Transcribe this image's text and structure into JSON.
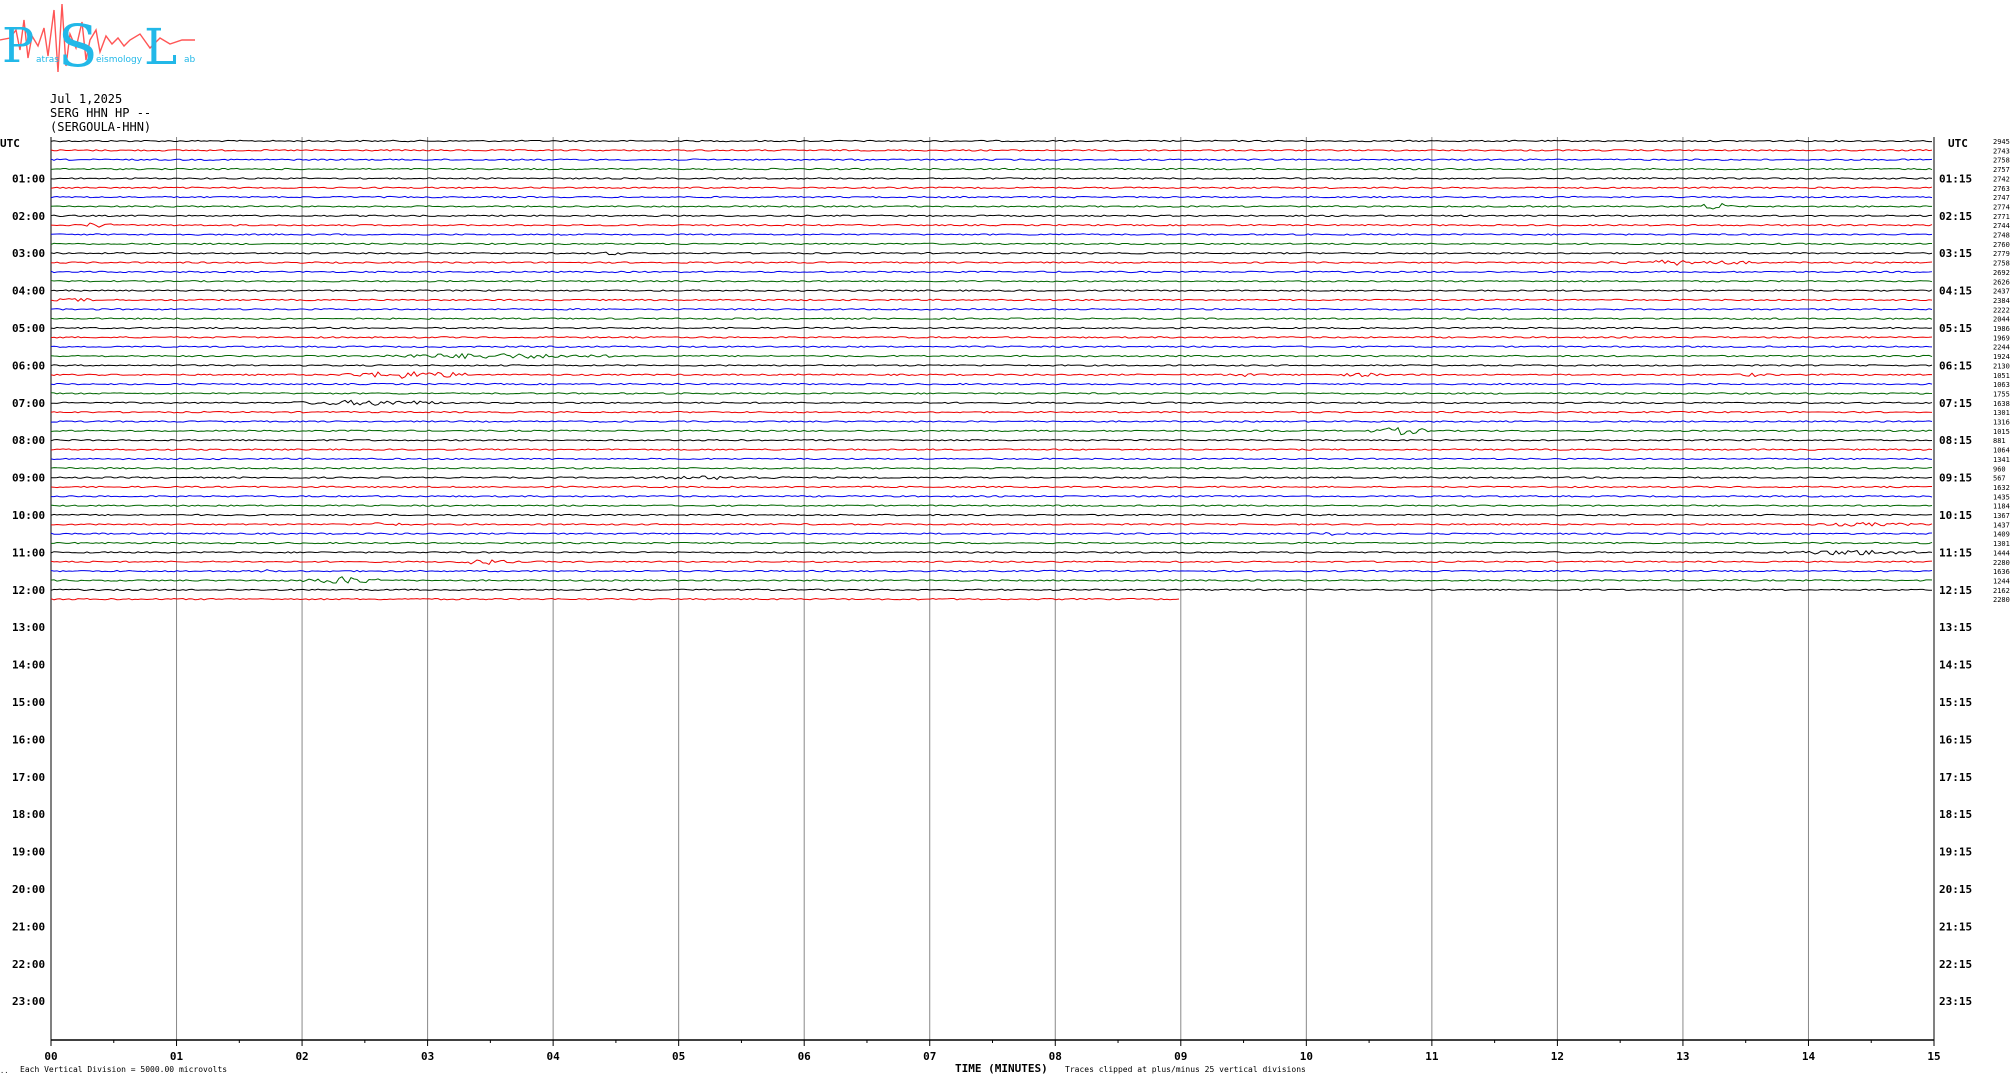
{
  "header": {
    "date": "Jul 1,2025",
    "station": "SERG HHN HP --",
    "channel_name": "(SERGOULA-HHN)"
  },
  "logo": {
    "letters": [
      "P",
      "S",
      "L"
    ],
    "small_text": [
      "atras",
      "eismology",
      "ab"
    ]
  },
  "colors": {
    "trace_cycle": [
      "#000000",
      "#ee0000",
      "#0000ee",
      "#006600"
    ]
  },
  "chart_data": {
    "type": "line",
    "title": "",
    "utc_label": "UTC",
    "left_hour_labels": [
      "01:00",
      "02:00",
      "03:00",
      "04:00",
      "05:00",
      "06:00",
      "07:00",
      "08:00",
      "09:00",
      "10:00",
      "11:00",
      "12:00",
      "13:00",
      "14:00",
      "15:00",
      "16:00",
      "17:00",
      "18:00",
      "19:00",
      "20:00",
      "21:00",
      "22:00",
      "23:00"
    ],
    "right_hour_labels": [
      "01:15",
      "02:15",
      "03:15",
      "04:15",
      "05:15",
      "06:15",
      "07:15",
      "08:15",
      "09:15",
      "10:15",
      "11:15",
      "12:15",
      "13:15",
      "14:15",
      "15:15",
      "16:15",
      "17:15",
      "18:15",
      "19:15",
      "20:15",
      "21:15",
      "22:15",
      "23:15"
    ],
    "x_ticks": [
      "00",
      "01",
      "02",
      "03",
      "04",
      "05",
      "06",
      "07",
      "08",
      "09",
      "10",
      "11",
      "12",
      "13",
      "14",
      "15"
    ],
    "xlim": [
      0,
      15
    ],
    "xlabel": "TIME (MINUTES)",
    "clip_note": "Traces clipped at plus/minus 25 vertical divisions",
    "scale_note": "Each Vertical Division = 5000.00 microvolts",
    "corner_mark": "..",
    "trace_minutes_per_line": 15,
    "last_trace_end_minute": 9,
    "num_traces": 50,
    "trace_rms_values": [
      2945,
      2743,
      2758,
      2757,
      2742,
      2763,
      2747,
      2774,
      2771,
      2744,
      2748,
      2760,
      2779,
      2758,
      2692,
      2626,
      2437,
      2384,
      2222,
      2044,
      1986,
      1969,
      2244,
      1924,
      2130,
      1051,
      1063,
      1755,
      1638,
      1301,
      1316,
      1015,
      881,
      1064,
      1341,
      960,
      567,
      1632,
      1435,
      1184,
      1367,
      1437,
      1409,
      1301,
      1444,
      2280,
      1636,
      1244,
      2162,
      2280
    ],
    "events": [
      {
        "trace": 9,
        "start": 0.2,
        "end": 0.5,
        "amp": 3
      },
      {
        "trace": 7,
        "start": 13.1,
        "end": 13.4,
        "amp": 4
      },
      {
        "trace": 12,
        "start": 4.3,
        "end": 4.6,
        "amp": 2
      },
      {
        "trace": 13,
        "start": 12.4,
        "end": 13.6,
        "amp": 3
      },
      {
        "trace": 17,
        "start": 0.0,
        "end": 0.4,
        "amp": 2
      },
      {
        "trace": 23,
        "start": 2.5,
        "end": 4.5,
        "amp": 3
      },
      {
        "trace": 25,
        "start": 2.3,
        "end": 3.4,
        "amp": 4
      },
      {
        "trace": 25,
        "start": 9.3,
        "end": 9.7,
        "amp": 2
      },
      {
        "trace": 25,
        "start": 10.2,
        "end": 10.7,
        "amp": 2
      },
      {
        "trace": 25,
        "start": 13.4,
        "end": 13.7,
        "amp": 2
      },
      {
        "trace": 28,
        "start": 1.9,
        "end": 3.2,
        "amp": 3
      },
      {
        "trace": 31,
        "start": 10.5,
        "end": 11.0,
        "amp": 4
      },
      {
        "trace": 36,
        "start": 4.6,
        "end": 6.0,
        "amp": 2
      },
      {
        "trace": 41,
        "start": 2.4,
        "end": 2.9,
        "amp": 2
      },
      {
        "trace": 41,
        "start": 13.9,
        "end": 15.0,
        "amp": 2
      },
      {
        "trace": 42,
        "start": 10.0,
        "end": 10.5,
        "amp": 2
      },
      {
        "trace": 44,
        "start": 13.8,
        "end": 14.9,
        "amp": 3
      },
      {
        "trace": 45,
        "start": 3.2,
        "end": 3.7,
        "amp": 3
      },
      {
        "trace": 46,
        "start": 1.6,
        "end": 1.8,
        "amp": 2
      },
      {
        "trace": 47,
        "start": 2.0,
        "end": 2.7,
        "amp": 4
      }
    ]
  }
}
